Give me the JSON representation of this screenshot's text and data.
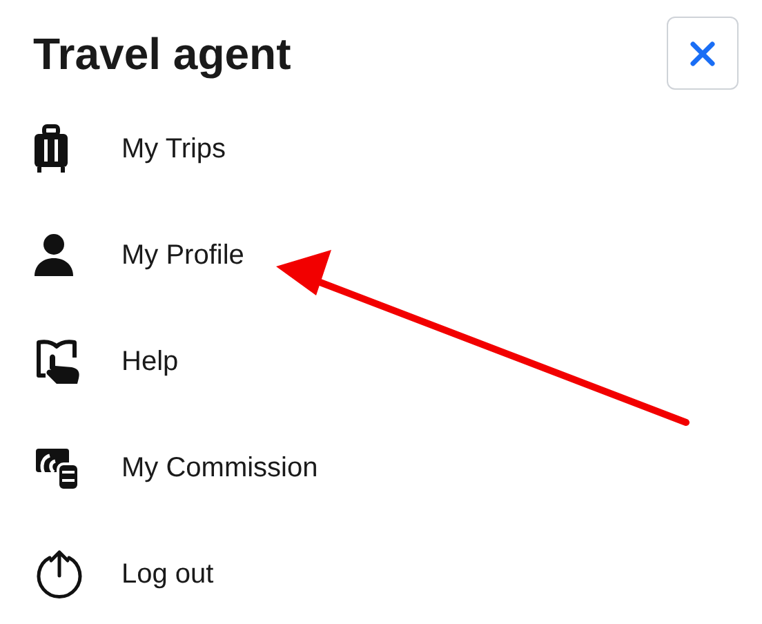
{
  "title": "Travel agent",
  "menu": [
    {
      "label": "My Trips"
    },
    {
      "label": "My Profile"
    },
    {
      "label": "Help"
    },
    {
      "label": "My Commission"
    },
    {
      "label": "Log out"
    }
  ]
}
